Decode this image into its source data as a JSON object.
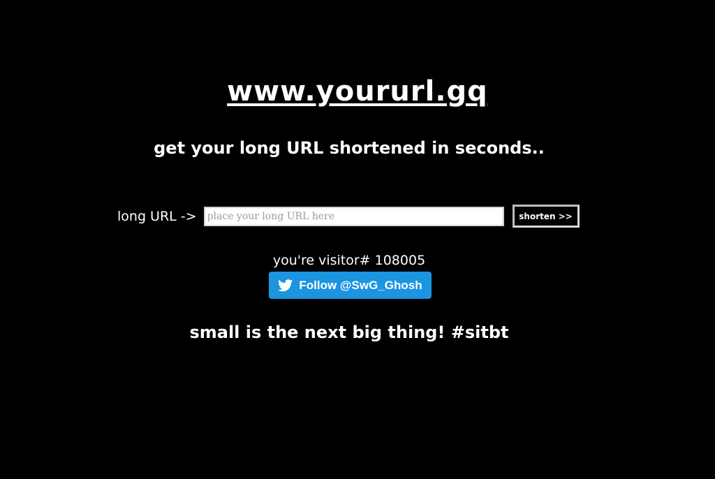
{
  "header": {
    "site_title": "www.yoururl.gq",
    "tagline": "get your long URL shortened in seconds.."
  },
  "form": {
    "label": "long URL ->",
    "input_placeholder": "place your long URL here",
    "input_value": "",
    "button_label": "shorten >>"
  },
  "visitor": {
    "text": "you're visitor# 108005"
  },
  "twitter": {
    "follow_label": "Follow @SwG_Ghosh",
    "icon": "twitter-bird-icon",
    "color": "#1b95e0"
  },
  "footer": {
    "slogan": "small is the next big thing! #sitbt"
  },
  "colors": {
    "background": "#000000",
    "text": "#ffffff"
  }
}
